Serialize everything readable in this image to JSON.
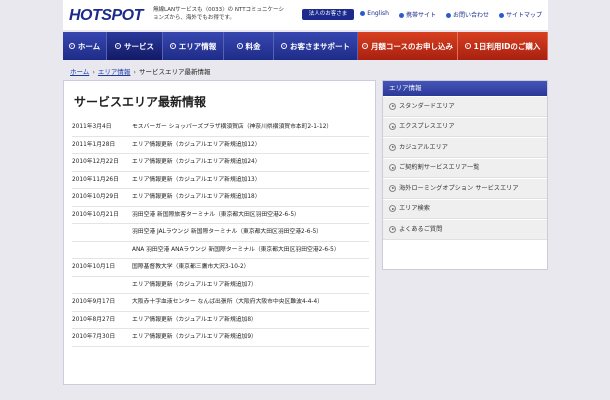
{
  "header": {
    "logo": "HOTSPOT",
    "tagline": "無線LANサービスも〈0033〉の NTTコミュニケーションズから、海外でもお得です。",
    "corp_button": "法人のお客さま",
    "links": [
      "English",
      "携帯サイト",
      "お問い合わせ",
      "サイトマップ"
    ]
  },
  "nav": {
    "items": [
      {
        "label": "ホーム"
      },
      {
        "label": "サービス"
      },
      {
        "label": "エリア情報"
      },
      {
        "label": "料金"
      },
      {
        "label": "お客さまサポート"
      },
      {
        "label": "月額コースのお申し込み"
      },
      {
        "label": "1日利用IDのご購入"
      }
    ]
  },
  "breadcrumb": {
    "home": "ホーム",
    "area": "エリア情報",
    "current": "サービスエリア最新情報"
  },
  "main": {
    "title": "サービスエリア最新情報",
    "news": [
      {
        "date": "2011年3月4日",
        "text": "モスバーガー ショッパーズプラザ横須賀店（神奈川県横須賀市本町2-1-12）"
      },
      {
        "date": "2011年1月28日",
        "text": "エリア情報更新（カジュアルエリア新規追加12）"
      },
      {
        "date": "2010年12月22日",
        "text": "エリア情報更新（カジュアルエリア新規追加24）"
      },
      {
        "date": "2010年11月26日",
        "text": "エリア情報更新（カジュアルエリア新規追加13）"
      },
      {
        "date": "2010年10月29日",
        "text": "エリア情報更新（カジュアルエリア新規追加18）"
      },
      {
        "date": "2010年10月21日",
        "text": "羽田空港 新国際旅客ターミナル（東京都大田区羽田空港2-6-5）"
      },
      {
        "date": "",
        "text": "羽田空港 JALラウンジ 新国際ターミナル（東京都大田区羽田空港2-6-5）"
      },
      {
        "date": "",
        "text": "ANA 羽田空港 ANAラウンジ 新国際ターミナル（東京都大田区羽田空港2-6-5）"
      },
      {
        "date": "2010年10月1日",
        "text": "国際基督教大学（東京都三鷹市大沢3-10-2）"
      },
      {
        "date": "",
        "text": "エリア情報更新（カジュアルエリア新規追加7）"
      },
      {
        "date": "2010年9月17日",
        "text": "大阪赤十字血液センター なんば出張所（大阪府大阪市中央区難波4-4-4）"
      },
      {
        "date": "2010年8月27日",
        "text": "エリア情報更新（カジュアルエリア新規追加8）"
      },
      {
        "date": "2010年7月30日",
        "text": "エリア情報更新（カジュアルエリア新規追加9）"
      }
    ]
  },
  "sidebar": {
    "heading": "エリア情報",
    "items": [
      {
        "label": "スタンダードエリア"
      },
      {
        "label": "エクスプレスエリア"
      },
      {
        "label": "カジュアルエリア"
      },
      {
        "label": "ご契約割サービスエリア一覧"
      },
      {
        "label": "海外ローミングオプション サービスエリア"
      },
      {
        "label": "エリア検索"
      },
      {
        "label": "よくあるご質問"
      }
    ]
  },
  "colors": {
    "brand": "#1b2a8c",
    "nav_red": "#c83018",
    "sidebar_head": "#2a3898"
  }
}
